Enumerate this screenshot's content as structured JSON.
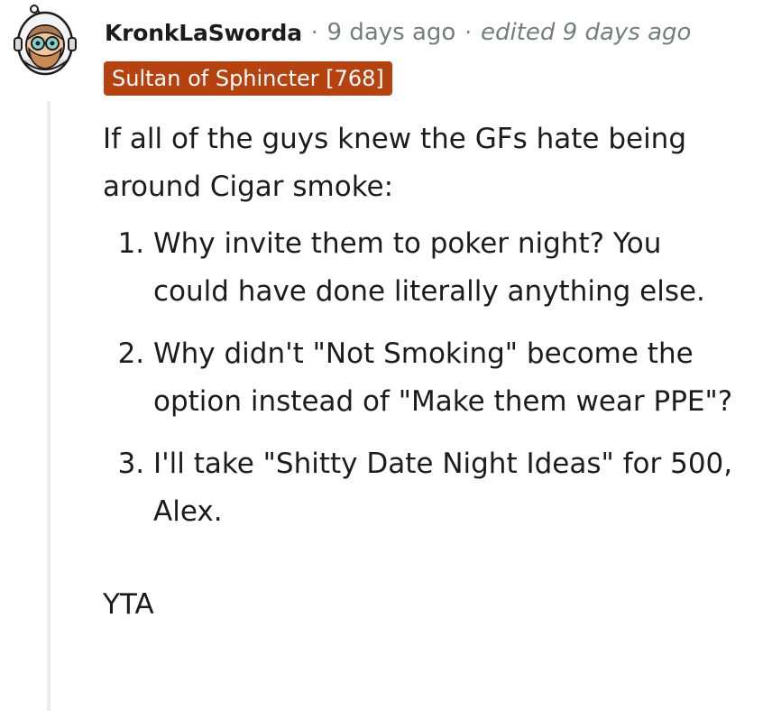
{
  "comment": {
    "username": "KronkLaSworda",
    "separator": "·",
    "posted": "9 days ago",
    "edited": "edited 9 days ago",
    "flair": "Sultan of Sphincter [768]",
    "intro": "If all of the guys knew the GFs hate being around Cigar smoke:",
    "list": [
      "Why invite them to poker night? You could have done literally anything else.",
      "Why didn't \"Not Smoking\" become the option instead of \"Make them wear PPE\"?",
      "I'll take \"Shitty Date Night Ideas\" for 500, Alex."
    ],
    "closing": "YTA"
  },
  "colors": {
    "flair_bg": "#b5420f",
    "meta_gray": "#787c7e",
    "thread_line": "#ececec",
    "text": "#1c1c1c"
  },
  "icons": {
    "avatar": "reddit-snoo-astronaut-avatar-icon"
  }
}
